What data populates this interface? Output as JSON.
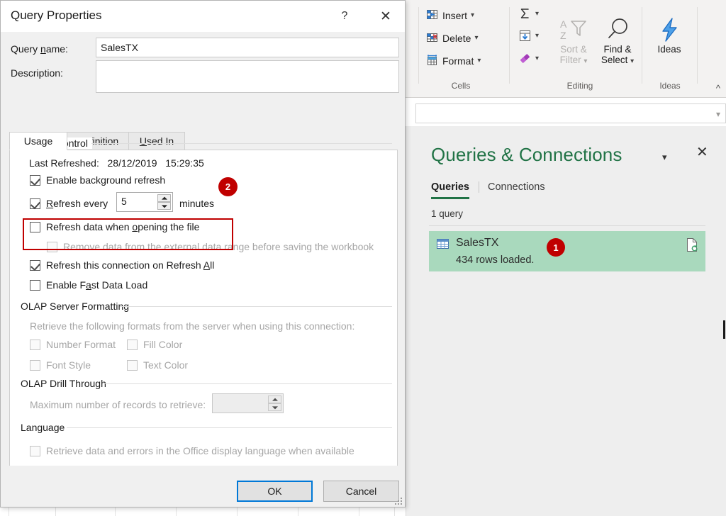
{
  "ribbon": {
    "cells": {
      "group_label": "Cells",
      "items": [
        {
          "label": "Insert",
          "icon": "insert-cells-icon",
          "has_chevron": true
        },
        {
          "label": "Delete",
          "icon": "delete-cells-icon",
          "has_chevron": true
        },
        {
          "label": "Format",
          "icon": "format-cells-icon",
          "has_chevron": true
        }
      ]
    },
    "editing": {
      "group_label": "Editing",
      "autosum_icon": "autosum-sigma-icon",
      "fill_icon": "fill-down-icon",
      "clear_icon": "clear-eraser-icon",
      "sort_filter_label_line1": "Sort &",
      "sort_filter_label_line2": "Filter",
      "find_select_label_line1": "Find &",
      "find_select_label_line2": "Select"
    },
    "ideas": {
      "group_label": "Ideas",
      "button_label": "Ideas",
      "icon": "ideas-lightning-icon"
    },
    "collapse_icon": "collapse-ribbon-caret"
  },
  "queries_pane": {
    "title": "Queries & Connections",
    "dropdown_icon": "pane-options-caret",
    "close_icon": "pane-close-icon",
    "tabs": [
      {
        "label": "Queries",
        "active": true
      },
      {
        "label": "Connections",
        "active": false
      }
    ],
    "count_text": "1 query",
    "rows": [
      {
        "name": "SalesTX",
        "status": "434 rows loaded.",
        "table_icon": "query-table-icon",
        "refresh_icon": "refresh-document-icon",
        "badge": "1"
      }
    ]
  },
  "dialog": {
    "title": "Query Properties",
    "help_icon": "?",
    "close_icon": "✕",
    "fields": {
      "query_name_label": "Query name:",
      "query_name_value": "SalesTX",
      "description_label": "Description:",
      "description_value": ""
    },
    "tabs": [
      {
        "label": "Usage",
        "active": true
      },
      {
        "label": "Definition",
        "active": false
      },
      {
        "label": "Used In",
        "active": false
      }
    ],
    "refresh_control": {
      "group_title": "Refresh control",
      "last_refreshed_label": "Last Refreshed:",
      "last_refreshed_date": "28/12/2019",
      "last_refreshed_time": "15:29:35",
      "enable_background_refresh": {
        "label": "Enable background refresh",
        "checked": true
      },
      "refresh_every": {
        "label": "Refresh every",
        "checked": true,
        "value": "5",
        "unit": "minutes"
      },
      "refresh_on_open": {
        "label": "Refresh data when opening the file",
        "checked": false
      },
      "remove_data": {
        "label": "Remove data from the external data range before saving the workbook",
        "checked": false,
        "disabled": true
      },
      "refresh_all": {
        "label": "Refresh this connection on Refresh All",
        "checked": true
      },
      "fast_data_load": {
        "label": "Enable Fast Data Load",
        "checked": false
      }
    },
    "olap_formatting": {
      "group_title": "OLAP Server Formatting",
      "description": "Retrieve the following formats from the server when using this connection:",
      "options": [
        {
          "label": "Number Format",
          "checked": false,
          "disabled": true
        },
        {
          "label": "Fill Color",
          "checked": false,
          "disabled": true
        },
        {
          "label": "Font Style",
          "checked": false,
          "disabled": true
        },
        {
          "label": "Text Color",
          "checked": false,
          "disabled": true
        }
      ]
    },
    "olap_drill": {
      "group_title": "OLAP Drill Through",
      "max_records_label": "Maximum number of records to retrieve:",
      "max_records_value": ""
    },
    "language": {
      "group_title": "Language",
      "option": {
        "label": "Retrieve data and errors in the Office display language when available",
        "checked": false,
        "disabled": true
      }
    },
    "buttons": {
      "ok": "OK",
      "cancel": "Cancel"
    }
  },
  "annotations": {
    "badge_1": "1",
    "badge_2": "2"
  },
  "colors": {
    "excel_green": "#217346",
    "annotation_red": "#c00000",
    "row_highlight": "#a9d9bd",
    "focus_blue": "#0078d7"
  }
}
